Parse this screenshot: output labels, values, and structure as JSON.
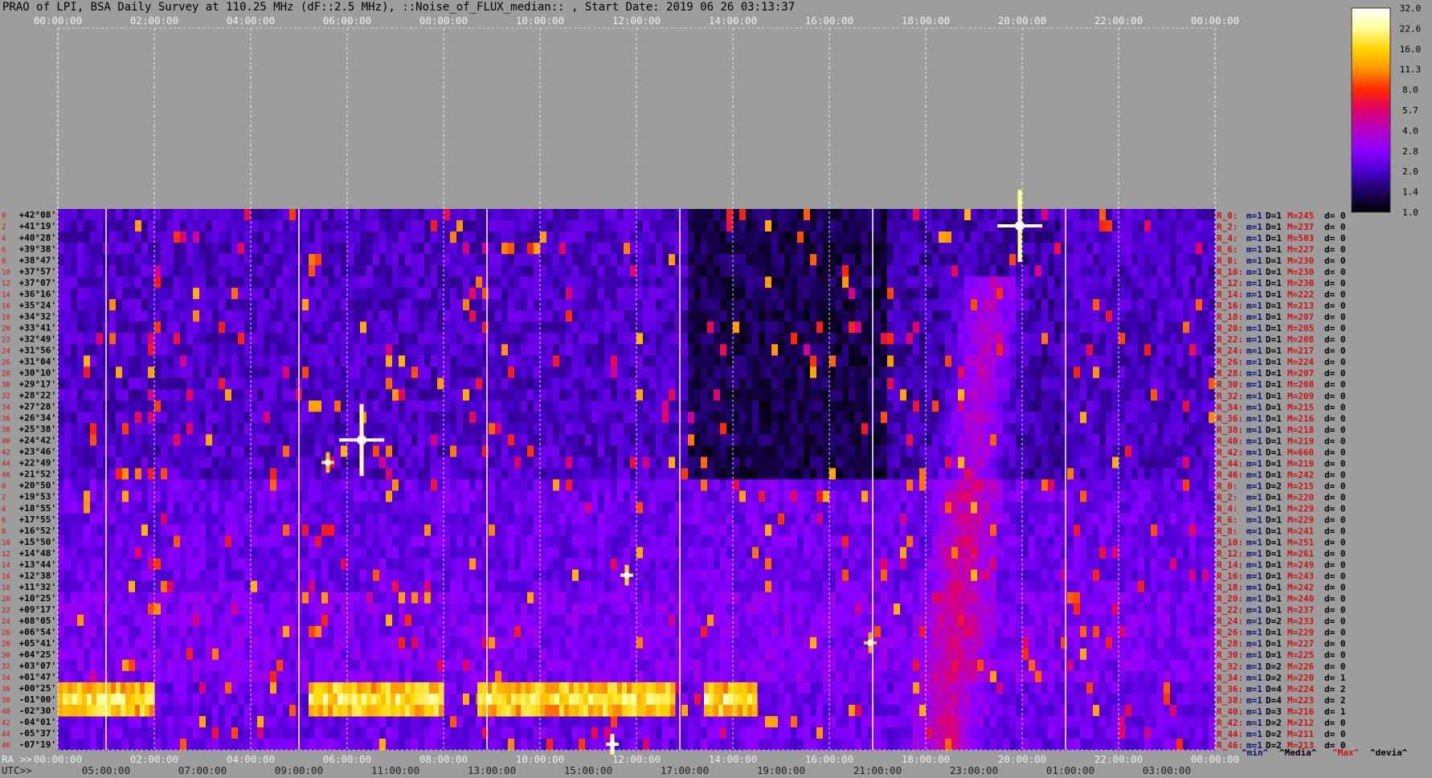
{
  "chart_data": {
    "type": "heatmap",
    "title": "PRAO of LPI, BSA Daily Survey at 110.25 MHz (dF::2.5 MHz), ::Noise_of_FLUX_median:: , Start Date: 2019 06 26 03:13:37",
    "top_axis_ticks": [
      "00:00:00",
      "02:00:00",
      "04:00:00",
      "06:00:00",
      "08:00:00",
      "10:00:00",
      "12:00:00",
      "14:00:00",
      "16:00:00",
      "18:00:00",
      "20:00:00",
      "22:00:00",
      "00:00:00"
    ],
    "ra_axis_label": "RA >>",
    "ra_ticks": [
      "00:00:00",
      "02:00:00",
      "04:00:00",
      "06:00:00",
      "08:00:00",
      "10:00:00",
      "12:00:00",
      "14:00:00",
      "16:00:00",
      "18:00:00",
      "20:00:00",
      "22:00:00",
      "00:00:00"
    ],
    "utc_axis_label": "UTC>>",
    "utc_ticks": [
      "05:00:00",
      "07:00:00",
      "09:00:00",
      "11:00:00",
      "13:00:00",
      "15:00:00",
      "17:00:00",
      "19:00:00",
      "21:00:00",
      "23:00:00",
      "01:00:00",
      "03:00:00"
    ],
    "row_indices": [
      "0",
      "2",
      "4",
      "6",
      "8",
      "10",
      "12",
      "14",
      "16",
      "18",
      "20",
      "22",
      "24",
      "26",
      "28",
      "30",
      "32",
      "34",
      "36",
      "38",
      "40",
      "42",
      "44",
      "46",
      "0",
      "2",
      "4",
      "6",
      "8",
      "10",
      "12",
      "14",
      "16",
      "18",
      "20",
      "22",
      "24",
      "26",
      "28",
      "30",
      "32",
      "34",
      "36",
      "38",
      "40",
      "42",
      "44",
      "46"
    ],
    "declinations": [
      "+42°08'",
      "+41°19'",
      "+40°28'",
      "+39°38'",
      "+38°47'",
      "+37°57'",
      "+37°07'",
      "+36°16'",
      "+35°24'",
      "+34°32'",
      "+33°41'",
      "+32°49'",
      "+31°56'",
      "+31°04'",
      "+30°10'",
      "+29°17'",
      "+28°22'",
      "+27°28'",
      "+26°34'",
      "+25°38'",
      "+24°42'",
      "+23°46'",
      "+22°49'",
      "+21°52'",
      "+20°50'",
      "+19°53'",
      "+18°55'",
      "+17°55'",
      "+16°52'",
      "+15°50'",
      "+14°48'",
      "+13°44'",
      "+12°38'",
      "+11°32'",
      "+10°25'",
      "+09°17'",
      "+08°05'",
      "+06°54'",
      "+05°41'",
      "+04°25'",
      "+03°07'",
      "+01°47'",
      "+00°25'",
      "-01°00'",
      "-02°30'",
      "-04°01'",
      "-05°37'",
      "-07°19'"
    ],
    "row_stats": [
      {
        "r": "R_0:",
        "m": "m=1",
        "D": "D=1",
        "M": "M=245",
        "d": "d= 0"
      },
      {
        "r": "R_2:",
        "m": "m=1",
        "D": "D=1",
        "M": "M=237",
        "d": "d= 0"
      },
      {
        "r": "R_4:",
        "m": "m=1",
        "D": "D=1",
        "M": "M=503",
        "d": "d= 0"
      },
      {
        "r": "R_6:",
        "m": "m=1",
        "D": "D=1",
        "M": "M=227",
        "d": "d= 0"
      },
      {
        "r": "R_8:",
        "m": "m=1",
        "D": "D=1",
        "M": "M=230",
        "d": "d= 0"
      },
      {
        "r": "R_10:",
        "m": "m=1",
        "D": "D=1",
        "M": "M=230",
        "d": "d= 0"
      },
      {
        "r": "R_12:",
        "m": "m=1",
        "D": "D=1",
        "M": "M=230",
        "d": "d= 0"
      },
      {
        "r": "R_14:",
        "m": "m=1",
        "D": "D=1",
        "M": "M=222",
        "d": "d= 0"
      },
      {
        "r": "R_16:",
        "m": "m=1",
        "D": "D=1",
        "M": "M=213",
        "d": "d= 0"
      },
      {
        "r": "R_18:",
        "m": "m=1",
        "D": "D=1",
        "M": "M=207",
        "d": "d= 0"
      },
      {
        "r": "R_20:",
        "m": "m=1",
        "D": "D=1",
        "M": "M=205",
        "d": "d= 0"
      },
      {
        "r": "R_22:",
        "m": "m=1",
        "D": "D=1",
        "M": "M=208",
        "d": "d= 0"
      },
      {
        "r": "R_24:",
        "m": "m=1",
        "D": "D=1",
        "M": "M=217",
        "d": "d= 0"
      },
      {
        "r": "R_26:",
        "m": "m=1",
        "D": "D=1",
        "M": "M=224",
        "d": "d= 0"
      },
      {
        "r": "R_28:",
        "m": "m=1",
        "D": "D=1",
        "M": "M=207",
        "d": "d= 0"
      },
      {
        "r": "R_30:",
        "m": "m=1",
        "D": "D=1",
        "M": "M=208",
        "d": "d= 0"
      },
      {
        "r": "R_32:",
        "m": "m=1",
        "D": "D=1",
        "M": "M=209",
        "d": "d= 0"
      },
      {
        "r": "R_34:",
        "m": "m=1",
        "D": "D=1",
        "M": "M=215",
        "d": "d= 0"
      },
      {
        "r": "R_36:",
        "m": "m=1",
        "D": "D=1",
        "M": "M=216",
        "d": "d= 0"
      },
      {
        "r": "R_38:",
        "m": "m=1",
        "D": "D=1",
        "M": "M=218",
        "d": "d= 0"
      },
      {
        "r": "R_40:",
        "m": "m=1",
        "D": "D=1",
        "M": "M=219",
        "d": "d= 0"
      },
      {
        "r": "R_42:",
        "m": "m=1",
        "D": "D=1",
        "M": "M=660",
        "d": "d= 0"
      },
      {
        "r": "R_44:",
        "m": "m=1",
        "D": "D=1",
        "M": "M=219",
        "d": "d= 0"
      },
      {
        "r": "R_46:",
        "m": "m=1",
        "D": "D=1",
        "M": "M=242",
        "d": "d= 0"
      },
      {
        "r": "R_0:",
        "m": "m=1",
        "D": "D=2",
        "M": "M=215",
        "d": "d= 0"
      },
      {
        "r": "R_2:",
        "m": "m=1",
        "D": "D=1",
        "M": "M=220",
        "d": "d= 0"
      },
      {
        "r": "R_4:",
        "m": "m=1",
        "D": "D=1",
        "M": "M=229",
        "d": "d= 0"
      },
      {
        "r": "R_6:",
        "m": "m=1",
        "D": "D=1",
        "M": "M=229",
        "d": "d= 0"
      },
      {
        "r": "R_8:",
        "m": "m=1",
        "D": "D=1",
        "M": "M=241",
        "d": "d= 0"
      },
      {
        "r": "R_10:",
        "m": "m=1",
        "D": "D=1",
        "M": "M=251",
        "d": "d= 0"
      },
      {
        "r": "R_12:",
        "m": "m=1",
        "D": "D=1",
        "M": "M=261",
        "d": "d= 0"
      },
      {
        "r": "R_14:",
        "m": "m=1",
        "D": "D=1",
        "M": "M=249",
        "d": "d= 0"
      },
      {
        "r": "R_16:",
        "m": "m=1",
        "D": "D=1",
        "M": "M=243",
        "d": "d= 0"
      },
      {
        "r": "R_18:",
        "m": "m=1",
        "D": "D=1",
        "M": "M=242",
        "d": "d= 0"
      },
      {
        "r": "R_20:",
        "m": "m=1",
        "D": "D=1",
        "M": "M=240",
        "d": "d= 0"
      },
      {
        "r": "R_22:",
        "m": "m=1",
        "D": "D=1",
        "M": "M=237",
        "d": "d= 0"
      },
      {
        "r": "R_24:",
        "m": "m=1",
        "D": "D=2",
        "M": "M=233",
        "d": "d= 0"
      },
      {
        "r": "R_26:",
        "m": "m=1",
        "D": "D=1",
        "M": "M=229",
        "d": "d= 0"
      },
      {
        "r": "R_28:",
        "m": "m=1",
        "D": "D=1",
        "M": "M=227",
        "d": "d= 0"
      },
      {
        "r": "R_30:",
        "m": "m=1",
        "D": "D=1",
        "M": "M=225",
        "d": "d= 0"
      },
      {
        "r": "R_32:",
        "m": "m=1",
        "D": "D=2",
        "M": "M=226",
        "d": "d= 0"
      },
      {
        "r": "R_34:",
        "m": "m=1",
        "D": "D=2",
        "M": "M=220",
        "d": "d= 1"
      },
      {
        "r": "R_36:",
        "m": "m=1",
        "D": "D=4",
        "M": "M=224",
        "d": "d= 2"
      },
      {
        "r": "R_38:",
        "m": "m=1",
        "D": "D=4",
        "M": "M=223",
        "d": "d= 2"
      },
      {
        "r": "R_40:",
        "m": "m=1",
        "D": "D=3",
        "M": "M=216",
        "d": "d= 1"
      },
      {
        "r": "R_42:",
        "m": "m=1",
        "D": "D=2",
        "M": "M=212",
        "d": "d= 0"
      },
      {
        "r": "R_44:",
        "m": "m=1",
        "D": "D=2",
        "M": "M=211",
        "d": "d= 0"
      },
      {
        "r": "R_46:",
        "m": "m=1",
        "D": "D=2",
        "M": "M=213",
        "d": "d= 0"
      }
    ],
    "legend": [
      "^min^",
      "^Media^",
      "^Max^",
      "^devia^"
    ],
    "colorbar": {
      "ticks": [
        "32.0",
        "22.6",
        "16.0",
        "11.3",
        "8.0",
        "5.7",
        "4.0",
        "2.8",
        "2.0",
        "1.4",
        "1.0"
      ],
      "colors": [
        "#ffffff",
        "#ffff9a",
        "#ffd500",
        "#ff9400",
        "#ff2800",
        "#e00068",
        "#b400c8",
        "#8a00ff",
        "#4c00d0",
        "#1c0060",
        "#000000"
      ]
    },
    "sources": [
      {
        "ra_h": 6.3,
        "row": 20,
        "intensity": 1.0,
        "size": "large"
      },
      {
        "ra_h": 5.6,
        "row": 22,
        "intensity": 0.85,
        "size": "small"
      },
      {
        "ra_h": 19.95,
        "row": 1,
        "intensity": 1.0,
        "size": "large"
      },
      {
        "ra_h": 11.8,
        "row": 32,
        "intensity": 0.9,
        "size": "small"
      },
      {
        "ra_h": 11.5,
        "row": 47,
        "intensity": 1.0,
        "size": "small"
      },
      {
        "ra_h": 16.85,
        "row": 38,
        "intensity": 0.8,
        "size": "small"
      }
    ],
    "bright_band_rows": [
      42,
      43,
      44
    ],
    "bright_band_ra_segments": [
      [
        0.0,
        2.0
      ],
      [
        5.2,
        8.0
      ],
      [
        8.7,
        12.8
      ],
      [
        13.4,
        14.5
      ]
    ]
  }
}
